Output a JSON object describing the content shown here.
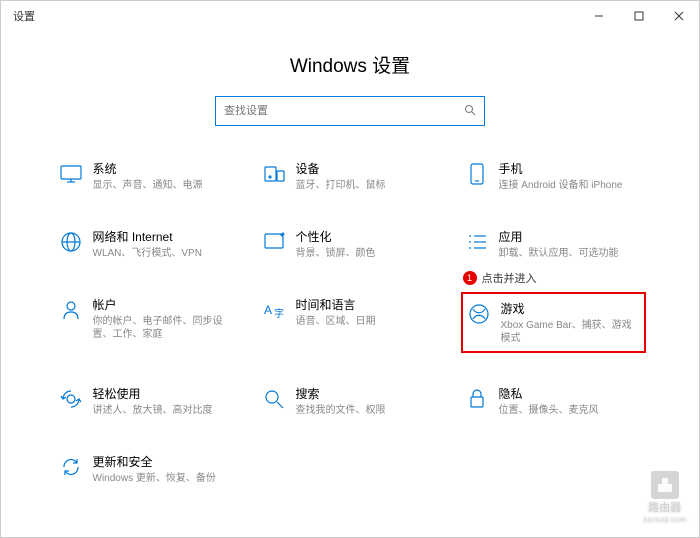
{
  "window": {
    "title": "设置"
  },
  "page_title": "Windows 设置",
  "search": {
    "placeholder": "查找设置"
  },
  "annotation": {
    "number": "1",
    "text": "点击并进入"
  },
  "tiles": [
    {
      "title": "系统",
      "sub": "显示、声音、通知、电源"
    },
    {
      "title": "设备",
      "sub": "蓝牙、打印机、鼠标"
    },
    {
      "title": "手机",
      "sub": "连接 Android 设备和 iPhone"
    },
    {
      "title": "网络和 Internet",
      "sub": "WLAN、飞行模式、VPN"
    },
    {
      "title": "个性化",
      "sub": "背景、锁屏、颜色"
    },
    {
      "title": "应用",
      "sub": "卸载、默认应用、可选功能"
    },
    {
      "title": "帐户",
      "sub": "你的帐户、电子邮件、同步设置、工作、家庭"
    },
    {
      "title": "时间和语言",
      "sub": "语音、区域、日期"
    },
    {
      "title": "游戏",
      "sub": "Xbox Game Bar、捕获、游戏模式"
    },
    {
      "title": "轻松使用",
      "sub": "讲述人、放大镜、高对比度"
    },
    {
      "title": "搜索",
      "sub": "查找我的文件、权限"
    },
    {
      "title": "隐私",
      "sub": "位置、摄像头、麦克风"
    },
    {
      "title": "更新和安全",
      "sub": "Windows 更新、恢复、备份"
    }
  ],
  "watermark": {
    "text": "路由器",
    "sub": "luyouqi.com"
  }
}
